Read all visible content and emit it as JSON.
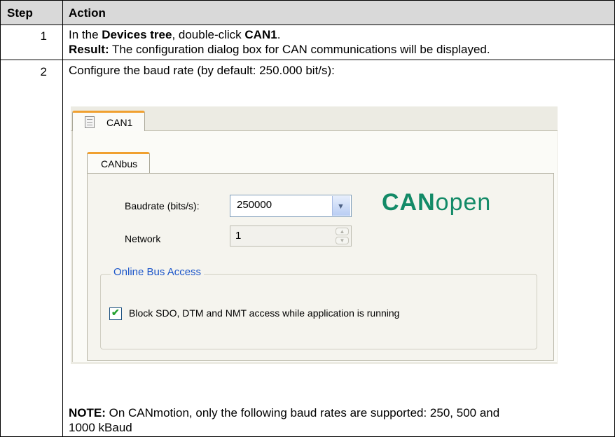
{
  "table": {
    "headers": {
      "step": "Step",
      "action": "Action"
    },
    "row1": {
      "step": "1",
      "line1_prefix": "In the ",
      "line1_bold1": "Devices tree",
      "line1_mid": ", double-click ",
      "line1_bold2": "CAN1",
      "line1_end": ".",
      "line2_bold": "Result:",
      "line2_text": " The configuration dialog box for CAN communications will be displayed."
    },
    "row2": {
      "step": "2",
      "intro": "Configure the baud rate (by default: 250.000 bit/s):",
      "note_bold": "NOTE:",
      "note_text": " On CANmotion, only the following baud rates are supported: 250, 500 and",
      "note_line2": "1000 kBaud"
    }
  },
  "dialog": {
    "outer_tab": "CAN1",
    "inner_tab": "CANbus",
    "baudrate_label": "Baudrate (bits/s):",
    "baudrate_value": "250000",
    "network_label": "Network",
    "network_value": "1",
    "logo_bold": "CAN",
    "logo_light": "open",
    "group_title": "Online Bus Access",
    "checkbox_label": "Block SDO, DTM and NMT access while application is running",
    "checkbox_checked": true
  },
  "colors": {
    "header_bg": "#d9d9d9",
    "tab_accent": "#f0a030",
    "logo": "#138a67",
    "group_title": "#1c56c9",
    "check": "#23a02d"
  }
}
